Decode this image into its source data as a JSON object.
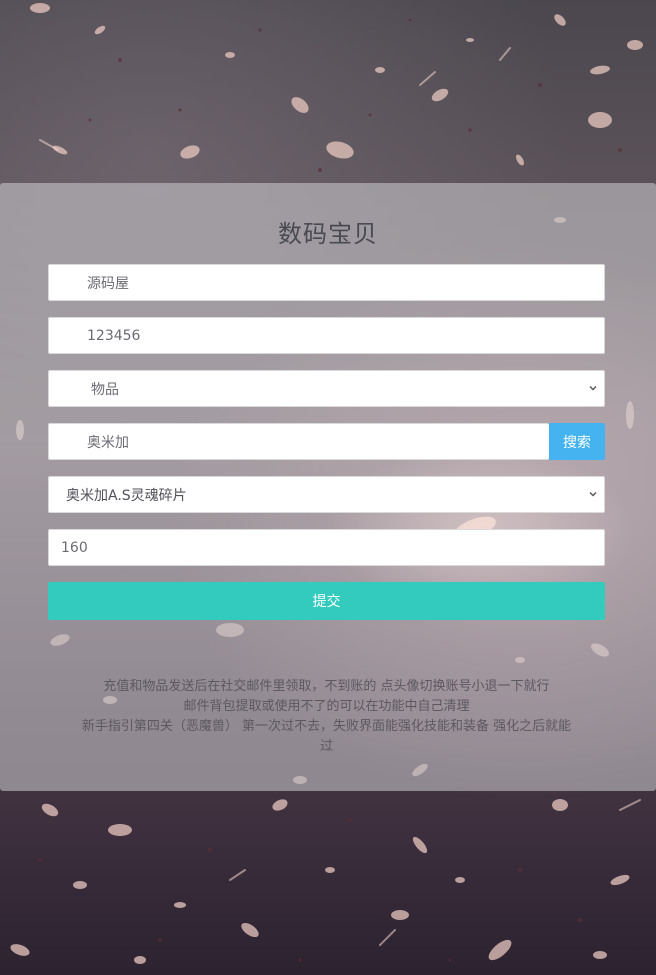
{
  "form": {
    "title": "数码宝贝",
    "account_value": "源码屋",
    "password_value": "123456",
    "category_select_value": "物品",
    "search_value": "奥米加",
    "search_button_label": "搜索",
    "item_select_value": "奥米加A.S灵魂碎片",
    "quantity_value": "160",
    "submit_button_label": "提交"
  },
  "notes": {
    "line1": "充值和物品发送后在社交邮件里领取，不到账的 点头像切换账号小退一下就行",
    "line2": "邮件背包提取或使用不了的可以在功能中自己清理",
    "line3": "新手指引第四关（恶魔兽） 第一次过不去，失败界面能强化技能和装备 强化之后就能",
    "line4": "过"
  },
  "colors": {
    "search_button": "#44b3ef",
    "submit_button": "#33cbbd",
    "panel": "rgba(205,205,210,0.55)"
  },
  "icons": {
    "select_arrow": "chevron-down-icon",
    "background": "petal-particles"
  }
}
